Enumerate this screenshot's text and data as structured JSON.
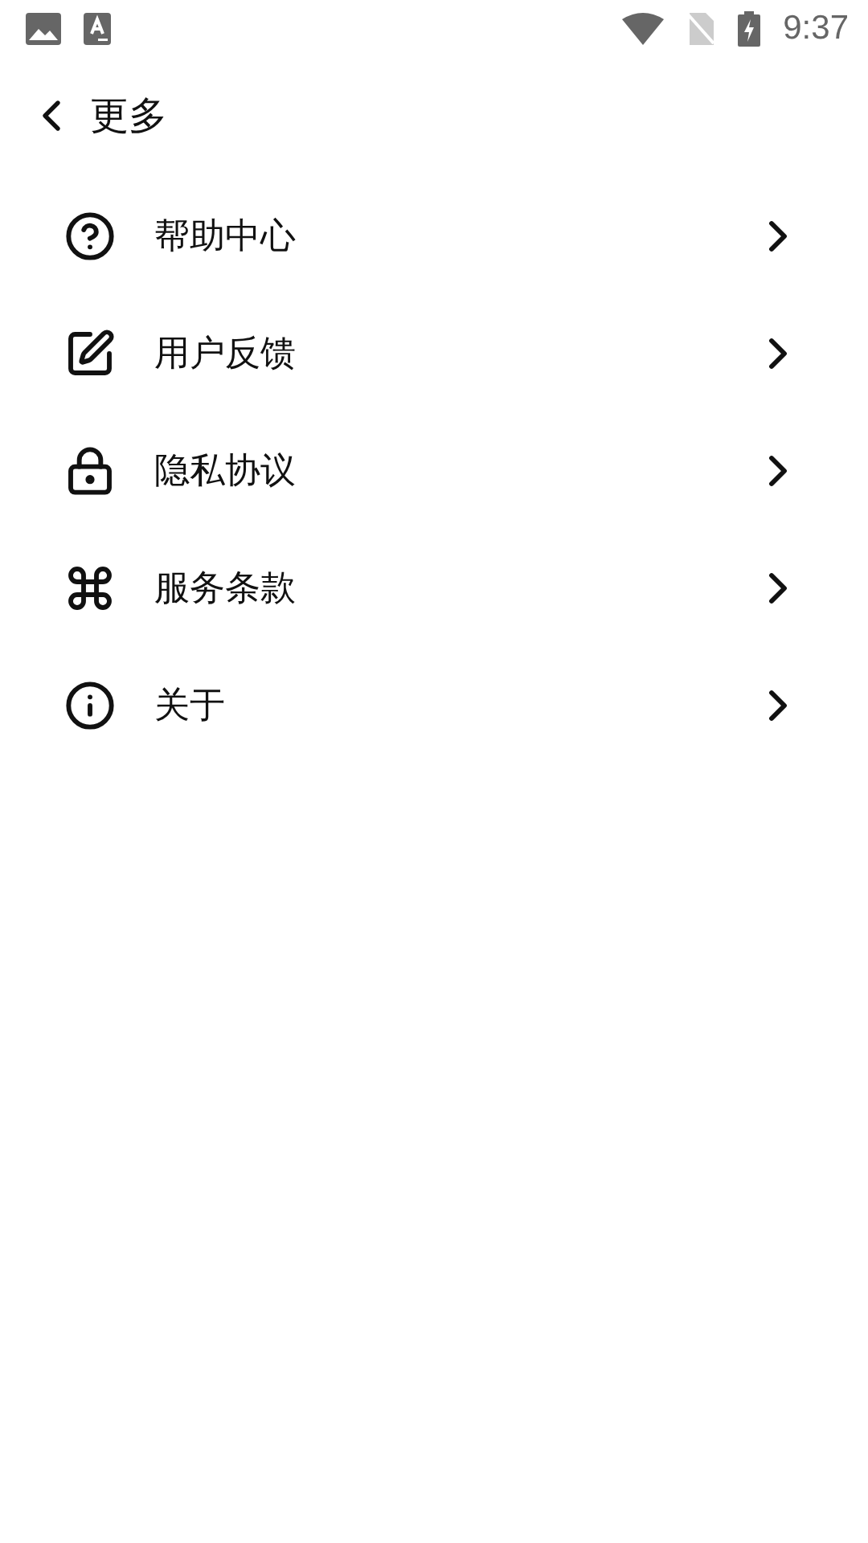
{
  "status_bar": {
    "time": "9:37"
  },
  "header": {
    "title": "更多"
  },
  "menu": [
    {
      "kind": "help",
      "label": "帮助中心"
    },
    {
      "kind": "feedback",
      "label": "用户反馈"
    },
    {
      "kind": "privacy",
      "label": "隐私协议"
    },
    {
      "kind": "terms",
      "label": "服务条款"
    },
    {
      "kind": "about",
      "label": "关于"
    }
  ]
}
